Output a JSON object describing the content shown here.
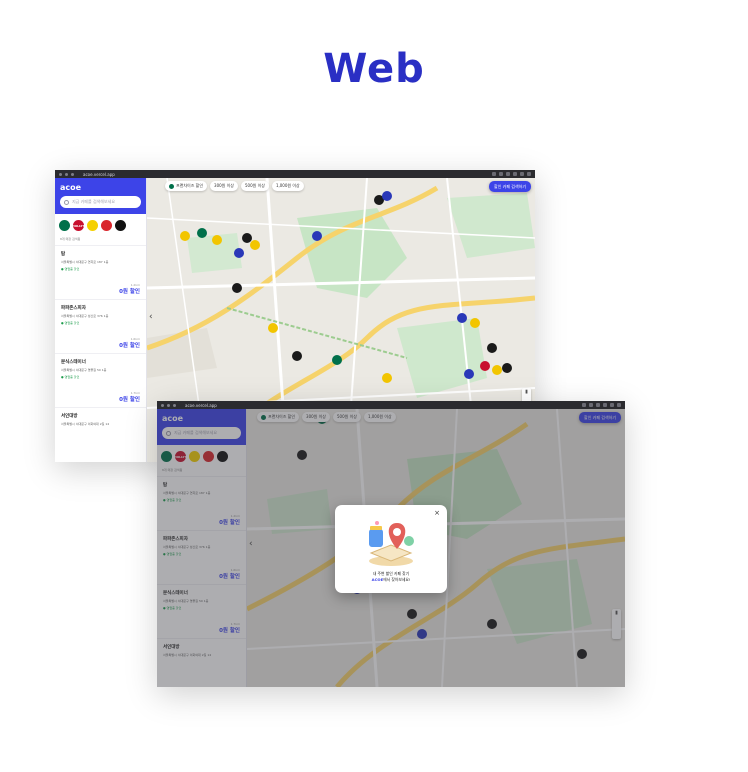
{
  "page": {
    "heading": "Web"
  },
  "browser": {
    "url": "acoe.vercel.app"
  },
  "app": {
    "logo": "acoe",
    "search_placeholder": "지금 카페를 검색해보세요",
    "sidebar_sub": "8개 매장 검색됨",
    "brands": [
      {
        "name": "starbucks",
        "label": ""
      },
      {
        "name": "hollys",
        "label": "HOLLYS"
      },
      {
        "name": "paik",
        "label": ""
      },
      {
        "name": "red",
        "label": ""
      },
      {
        "name": "black",
        "label": ""
      }
    ],
    "stores": [
      {
        "name": "탐",
        "addr": "서울특별시 서대문구 연희로 187 1층",
        "open": "● 영업중 할인",
        "dist": "1.2km",
        "discount": "0원 할인"
      },
      {
        "name": "파파존스피자",
        "addr": "서울특별시 서대문구 성산로 376 1층",
        "open": "● 영업중 할인",
        "dist": "1.6km",
        "discount": "0원 할인"
      },
      {
        "name": "분식스테이너",
        "addr": "서울특별시 서대문구 명물길 50 1층",
        "open": "● 영업중 할인",
        "dist": "1.7km",
        "discount": "0원 할인"
      },
      {
        "name": "서인대방",
        "addr": "서울특별시 서대문구 이화여대 2길 14",
        "open": "",
        "dist": "",
        "discount": ""
      }
    ],
    "chips": [
      "프랜차이즈 할인",
      "300원 이상",
      "500원 이상",
      "1,000원 이상"
    ],
    "cta": "할인 카페 검색하기",
    "modal": {
      "line1": "내 주변 할인 카페 찾기",
      "line2_hl": "ACOE",
      "line2_rest": "에서 찾아보세요!",
      "close": "×"
    }
  },
  "colors": {
    "brand": "#3d44e8",
    "heading": "#2a2fc4"
  }
}
